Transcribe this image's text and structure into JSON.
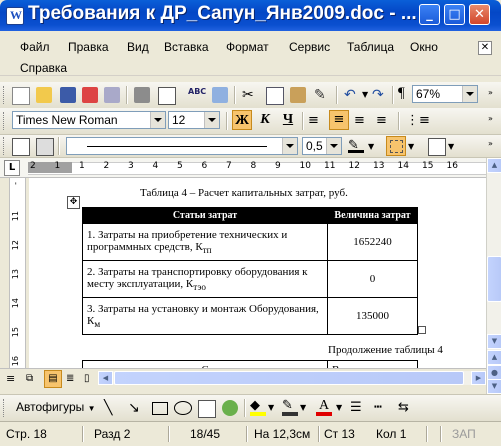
{
  "window": {
    "title": "Требования к ДР_Сапун_Янв2009.doc - ..."
  },
  "menu": [
    "Файл",
    "Правка",
    "Вид",
    "Вставка",
    "Формат",
    "Сервис",
    "Таблица",
    "Окно",
    "Справка"
  ],
  "toolbar": {
    "zoom": "67%",
    "paragraph_mark": "¶"
  },
  "formatting": {
    "font": "Times New Roman",
    "size": "12",
    "bold": "Ж",
    "italic": "К",
    "underline": "Ч"
  },
  "borders": {
    "line_width": "0,5"
  },
  "ruler": {
    "marks": [
      "2",
      "1",
      "1",
      "2",
      "3",
      "4",
      "5",
      "6",
      "7",
      "8",
      "9",
      "10",
      "11",
      "12",
      "13",
      "14",
      "15",
      "16"
    ]
  },
  "vruler": {
    "marks": [
      "-",
      "11",
      "12",
      "13",
      "14",
      "15",
      "16"
    ]
  },
  "document": {
    "caption": "Таблица 4 – Расчет капитальных затрат, руб.",
    "headers": [
      "Статьи затрат",
      "Величина затрат"
    ],
    "rows": [
      {
        "text": "1. Затраты на приобретение технических и программных средств, К",
        "sub": "тп",
        "value": "1652240"
      },
      {
        "text": "2. Затраты на транспортировку оборудования к месту эксплуатации, К",
        "sub": "тэо",
        "value": "0"
      },
      {
        "text": "3. Затраты на установку и монтаж Оборудования, К",
        "sub": "м",
        "value": "135000"
      }
    ],
    "continuation": "Продолжение таблицы 4",
    "cont_headers": [
      "С",
      "В"
    ]
  },
  "drawing": {
    "autoshapes": "Автофигуры"
  },
  "status": {
    "page": "Стр. 18",
    "section": "Разд 2",
    "pages": "18/45",
    "at": "На 12,3см",
    "line": "Ст 13",
    "col": "Кол 1",
    "zap": "ЗАП"
  }
}
